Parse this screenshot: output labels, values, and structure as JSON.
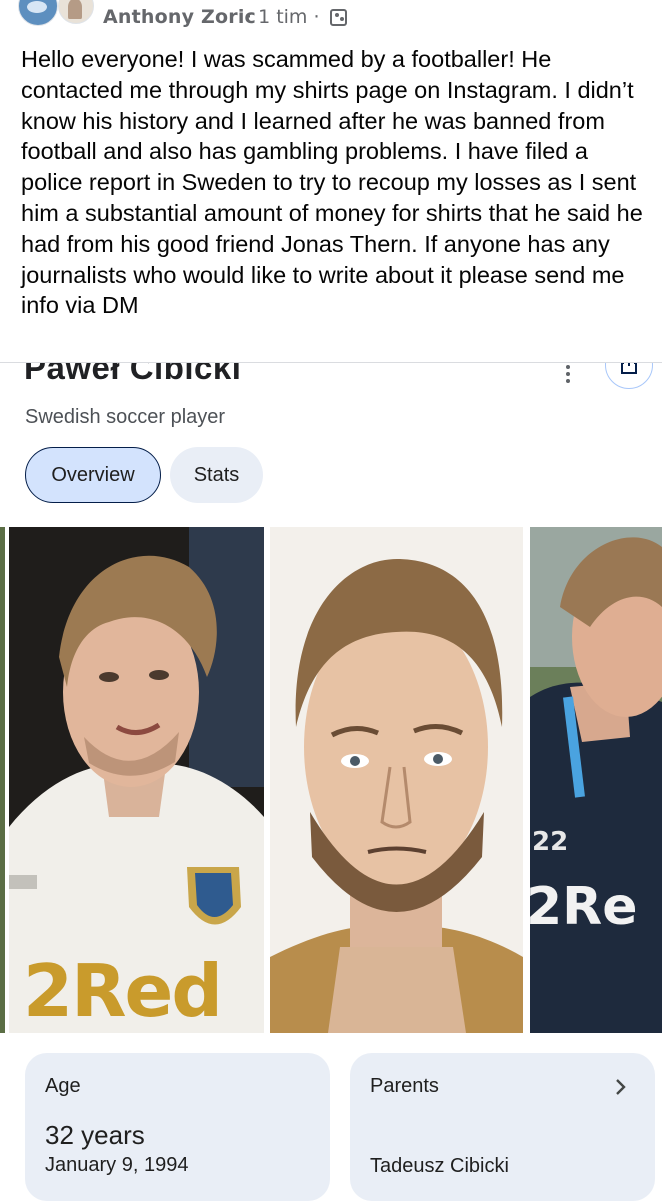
{
  "post": {
    "author": "Anthony Zoric",
    "meta": "· 1 tim ·",
    "text": "Hello everyone! I was scammed by a footballer! He contacted me through my shirts page on Instagram. I didn’t know his history and I learned after he was banned from football and also has gambling problems. I have filed a police report in Sweden to try to recoup my losses as I sent him a substantial amount of money for shirts that he said he had from his good friend Jonas Thern. If anyone has any journalists who would like to write about it please send me info via DM",
    "icons": [
      "avatar",
      "group-icon"
    ]
  },
  "knowledge_panel": {
    "title": "Paweł Cibicki",
    "subtitle": "Swedish soccer player",
    "tabs": [
      {
        "label": "Overview",
        "selected": true
      },
      {
        "label": "Stats",
        "selected": false
      }
    ],
    "photos": {
      "photo_1_text": "2Red",
      "photo_3_text": "2Re",
      "photo_3_shirt_number": "22"
    },
    "age_card": {
      "label": "Age",
      "value": "32 years",
      "date": "January 9, 1994"
    },
    "parents_card": {
      "label": "Parents",
      "name": "Tadeusz Cibicki"
    },
    "icons": [
      "more-vert-icon",
      "share-icon",
      "chevron-right-icon"
    ]
  },
  "colors": {
    "chip_selected_bg": "#d3e3fd",
    "chip_bg": "#e9eef6",
    "card_bg": "#e9eef6",
    "meta_gray": "#65676b"
  }
}
